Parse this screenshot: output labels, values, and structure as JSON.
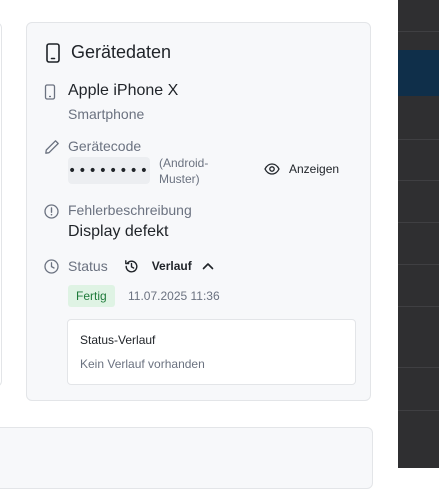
{
  "device_card": {
    "title": "Gerätedaten",
    "device": {
      "name": "Apple iPhone X",
      "type": "Smartphone"
    },
    "code": {
      "label": "Gerätecode",
      "masked_value": "••••••••",
      "note": "(Android-Muster)",
      "show_label": "Anzeigen"
    },
    "error": {
      "label": "Fehlerbeschreibung",
      "value": "Display defekt"
    },
    "status": {
      "label": "Status",
      "history_toggle_label": "Verlauf",
      "badge": "Fertig",
      "badge_color": "#dff3e4",
      "timestamp": "11.07.2025 11:36",
      "history_title": "Status-Verlauf",
      "history_empty": "Kein Verlauf vorhanden"
    }
  },
  "colors": {
    "overlay": "#2f2f31",
    "overlay_accent": "#0f2f4a",
    "card_background": "#f7f8fa"
  }
}
